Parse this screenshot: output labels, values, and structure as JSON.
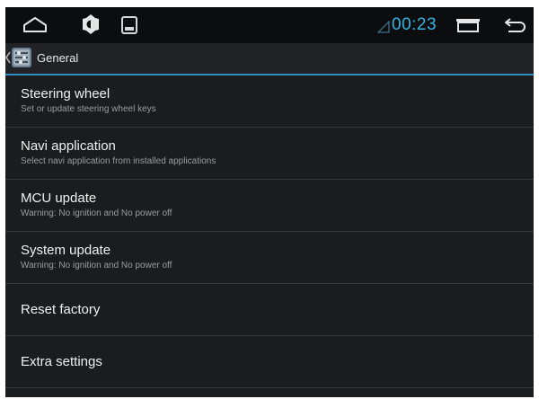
{
  "status_bar": {
    "icons": [
      "home-icon",
      "brightness-icon",
      "gallery-icon",
      "signal-icon",
      "recent-apps-icon",
      "back-icon"
    ],
    "time": "00:23",
    "accent_color": "#33b5e5"
  },
  "action_bar": {
    "title": "General",
    "icon": "settings-app-icon",
    "divider_color": "#2f8fc4"
  },
  "settings_list": [
    {
      "title": "Steering wheel",
      "summary": "Set or update steering wheel keys"
    },
    {
      "title": "Navi application",
      "summary": "Select navi application from installed applications"
    },
    {
      "title": "MCU update",
      "summary": "Warning: No ignition and No power off"
    },
    {
      "title": "System update",
      "summary": "Warning: No ignition and No power off"
    },
    {
      "title": "Reset factory"
    },
    {
      "title": "Extra settings"
    }
  ]
}
